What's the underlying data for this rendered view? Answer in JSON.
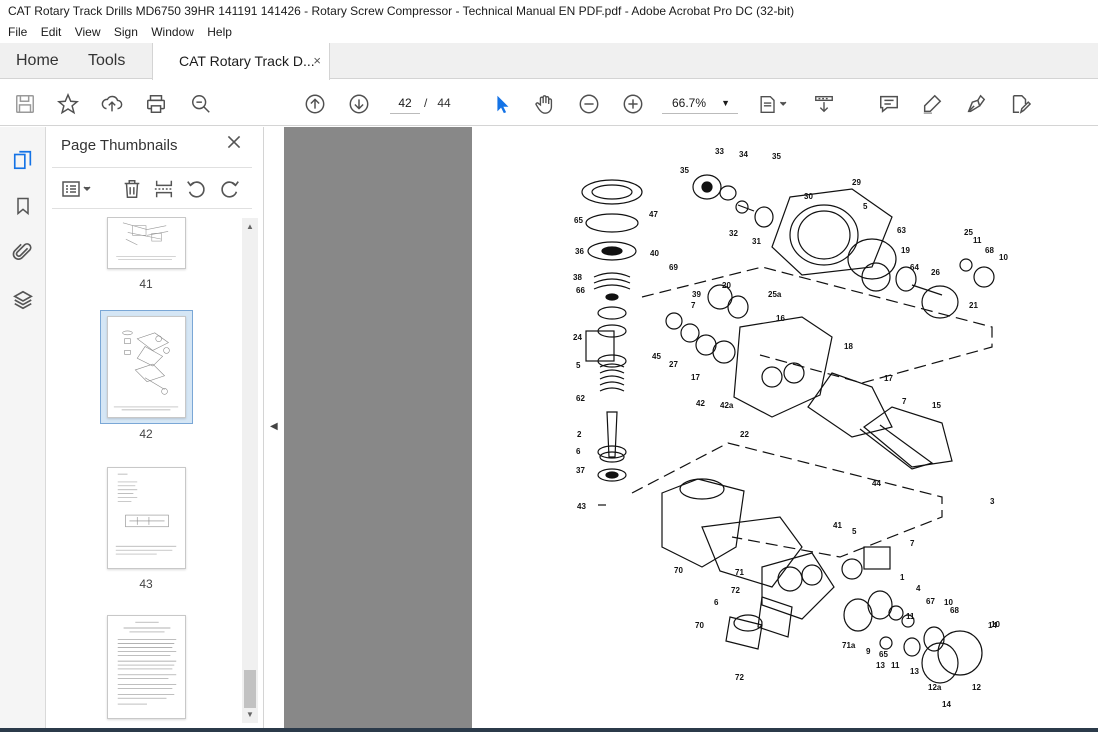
{
  "window": {
    "title": "CAT Rotary Track Drills MD6750 39HR 141191 141426 - Rotary Screw Compressor - Technical Manual EN PDF.pdf - Adobe Acrobat Pro DC (32-bit)"
  },
  "menu": [
    "File",
    "Edit",
    "View",
    "Sign",
    "Window",
    "Help"
  ],
  "tabs": {
    "home": "Home",
    "tools": "Tools",
    "document": "CAT Rotary Track D...",
    "close_glyph": "×"
  },
  "toolbar": {
    "current_page": "42",
    "page_separator": "/",
    "total_pages": "44",
    "zoom": "66.7%"
  },
  "panel": {
    "title": "Page Thumbnails",
    "thumbnails": [
      {
        "label": "41",
        "selected": false
      },
      {
        "label": "42",
        "selected": true
      },
      {
        "label": "43",
        "selected": false
      },
      {
        "label": "44",
        "selected": false
      }
    ]
  },
  "diagram": {
    "callouts": [
      "33",
      "34",
      "35",
      "35",
      "47",
      "65",
      "36",
      "30",
      "29",
      "32",
      "31",
      "5",
      "63",
      "38",
      "40",
      "69",
      "66",
      "39",
      "20",
      "25a",
      "16",
      "7",
      "19",
      "64",
      "26",
      "25",
      "11",
      "68",
      "10",
      "21",
      "24",
      "45",
      "27",
      "17",
      "18",
      "17",
      "5",
      "62",
      "42",
      "42a",
      "7",
      "15",
      "22",
      "2",
      "6",
      "37",
      "44",
      "43",
      "3",
      "41",
      "5",
      "7",
      "70",
      "71",
      "1",
      "4",
      "72",
      "67",
      "6",
      "10",
      "68",
      "11",
      "70",
      "71a",
      "9",
      "13",
      "14",
      "10",
      "65",
      "11",
      "13",
      "72",
      "12a",
      "12",
      "14"
    ],
    "accent_color": "#1473e6"
  }
}
